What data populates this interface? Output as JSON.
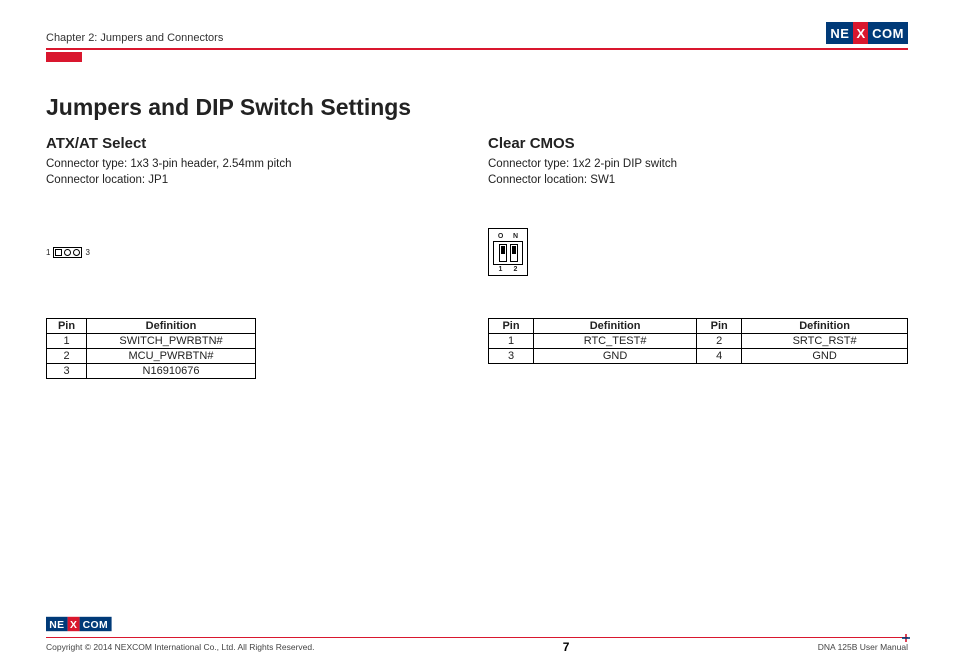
{
  "brand": {
    "left": "NE",
    "x": "X",
    "right": "COM"
  },
  "header": {
    "chapter": "Chapter 2: Jumpers and Connectors"
  },
  "title": "Jumpers and DIP Switch Settings",
  "sections": {
    "atx": {
      "title": "ATX/AT Select",
      "conn_type": "Connector type: 1x3 3-pin header, 2.54mm pitch",
      "conn_loc": "Connector location: JP1",
      "pin_left": "1",
      "pin_right": "3",
      "table_headers": {
        "pin": "Pin",
        "def": "Definition"
      },
      "rows": [
        {
          "pin": "1",
          "def": "SWITCH_PWRBTN#"
        },
        {
          "pin": "2",
          "def": "MCU_PWRBTN#"
        },
        {
          "pin": "3",
          "def": "N16910676"
        }
      ]
    },
    "cmos": {
      "title": "Clear CMOS",
      "conn_type": "Connector type: 1x2 2-pin DIP switch",
      "conn_loc": "Connector location: SW1",
      "dip_on": "O",
      "dip_n": "N",
      "dip_b1": "1",
      "dip_b2": "2",
      "table_headers": {
        "pin": "Pin",
        "def": "Definition"
      },
      "rows": [
        {
          "pin1": "1",
          "def1": "RTC_TEST#",
          "pin2": "2",
          "def2": "SRTC_RST#"
        },
        {
          "pin1": "3",
          "def1": "GND",
          "pin2": "4",
          "def2": "GND"
        }
      ]
    }
  },
  "footer": {
    "copyright": "Copyright © 2014 NEXCOM International Co., Ltd. All Rights Reserved.",
    "page": "7",
    "manual": "DNA 125B User Manual"
  }
}
